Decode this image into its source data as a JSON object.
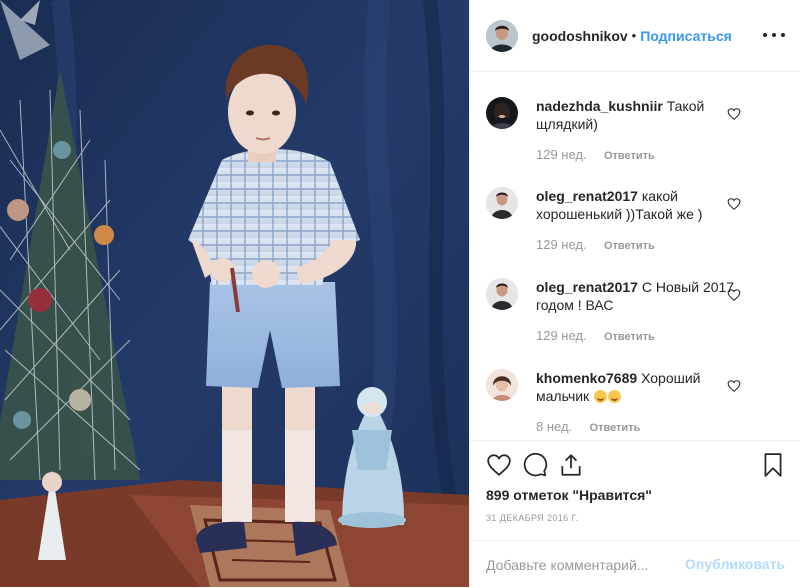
{
  "header": {
    "username": "goodoshnikov",
    "dot": "•",
    "follow_label": "Подписаться"
  },
  "comments": [
    {
      "username": "nadezhda_kushniir",
      "text": "Такой щлядкий)",
      "time": "129 нед.",
      "reply_label": "Ответить",
      "emoji": false
    },
    {
      "username": "oleg_renat2017",
      "text": "какой хорошенький ))Такой же )",
      "time": "129 нед.",
      "reply_label": "Ответить",
      "emoji": false
    },
    {
      "username": "oleg_renat2017",
      "text": "С Новый 2017 годом ! ВАС",
      "time": "129 нед.",
      "reply_label": "Ответить",
      "emoji": false
    },
    {
      "username": "khomenko7689",
      "text": "Хороший мальчик",
      "time": "8 нед.",
      "reply_label": "Ответить",
      "emoji": true
    }
  ],
  "post": {
    "likes": "899 отметок \"Нравится\"",
    "date": "31 ДЕКАБРЯ 2016 Г."
  },
  "add_comment": {
    "placeholder": "Добавьте комментарий...",
    "publish_label": "Опубликовать"
  },
  "colors": {
    "link_blue": "#3897f0",
    "publish_disabled": "#b3dbff",
    "muted_text": "#999999",
    "divider": "#efefef"
  },
  "icons": [
    "heart-icon",
    "comment-icon",
    "share-icon",
    "bookmark-icon",
    "more-options-icon"
  ]
}
